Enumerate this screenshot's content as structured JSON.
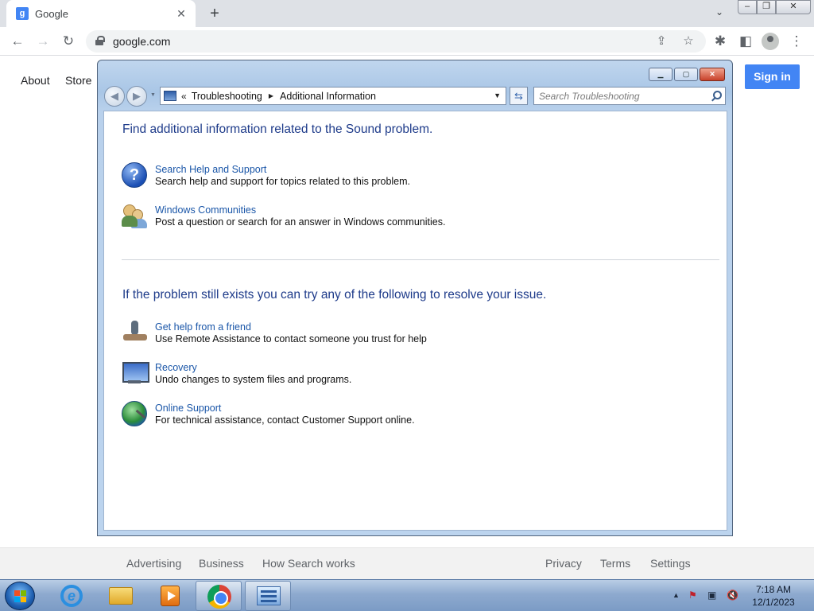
{
  "browser": {
    "tab_title": "Google",
    "tab_favicon": "g",
    "tab_close": "✕",
    "new_tab": "+",
    "url": "google.com"
  },
  "google": {
    "about": "About",
    "store": "Store",
    "sign_in": "Sign in",
    "footer_left": [
      "Advertising",
      "Business",
      "How Search works"
    ],
    "footer_right": [
      "Privacy",
      "Terms",
      "Settings"
    ]
  },
  "dialog": {
    "breadcrumb": {
      "prefix": "«",
      "items": [
        "Troubleshooting",
        "Additional Information"
      ]
    },
    "search_placeholder": "Search Troubleshooting",
    "heading1": "Find additional information related to the Sound problem.",
    "section1": [
      {
        "title": "Search Help and Support",
        "desc": "Search help and support for topics related to this problem.",
        "icon": "help-icon"
      },
      {
        "title": "Windows Communities",
        "desc": "Post a question or search for an answer in Windows communities.",
        "icon": "people-icon"
      }
    ],
    "heading2": "If the problem still exists you can try any of the following to resolve your issue.",
    "section2": [
      {
        "title": "Get help from a friend",
        "desc": "Use Remote Assistance to contact someone you trust for help",
        "icon": "remote-assistance-icon"
      },
      {
        "title": "Recovery",
        "desc": "Undo changes to system files and programs.",
        "icon": "recovery-icon"
      },
      {
        "title": "Online Support",
        "desc": "For technical assistance, contact Customer Support online.",
        "icon": "globe-icon"
      }
    ]
  },
  "taskbar": {
    "time": "7:18 AM",
    "date": "12/1/2023",
    "apps": [
      "internet-explorer",
      "windows-explorer",
      "media-player",
      "chrome",
      "control-panel"
    ],
    "active_app": "control-panel"
  }
}
